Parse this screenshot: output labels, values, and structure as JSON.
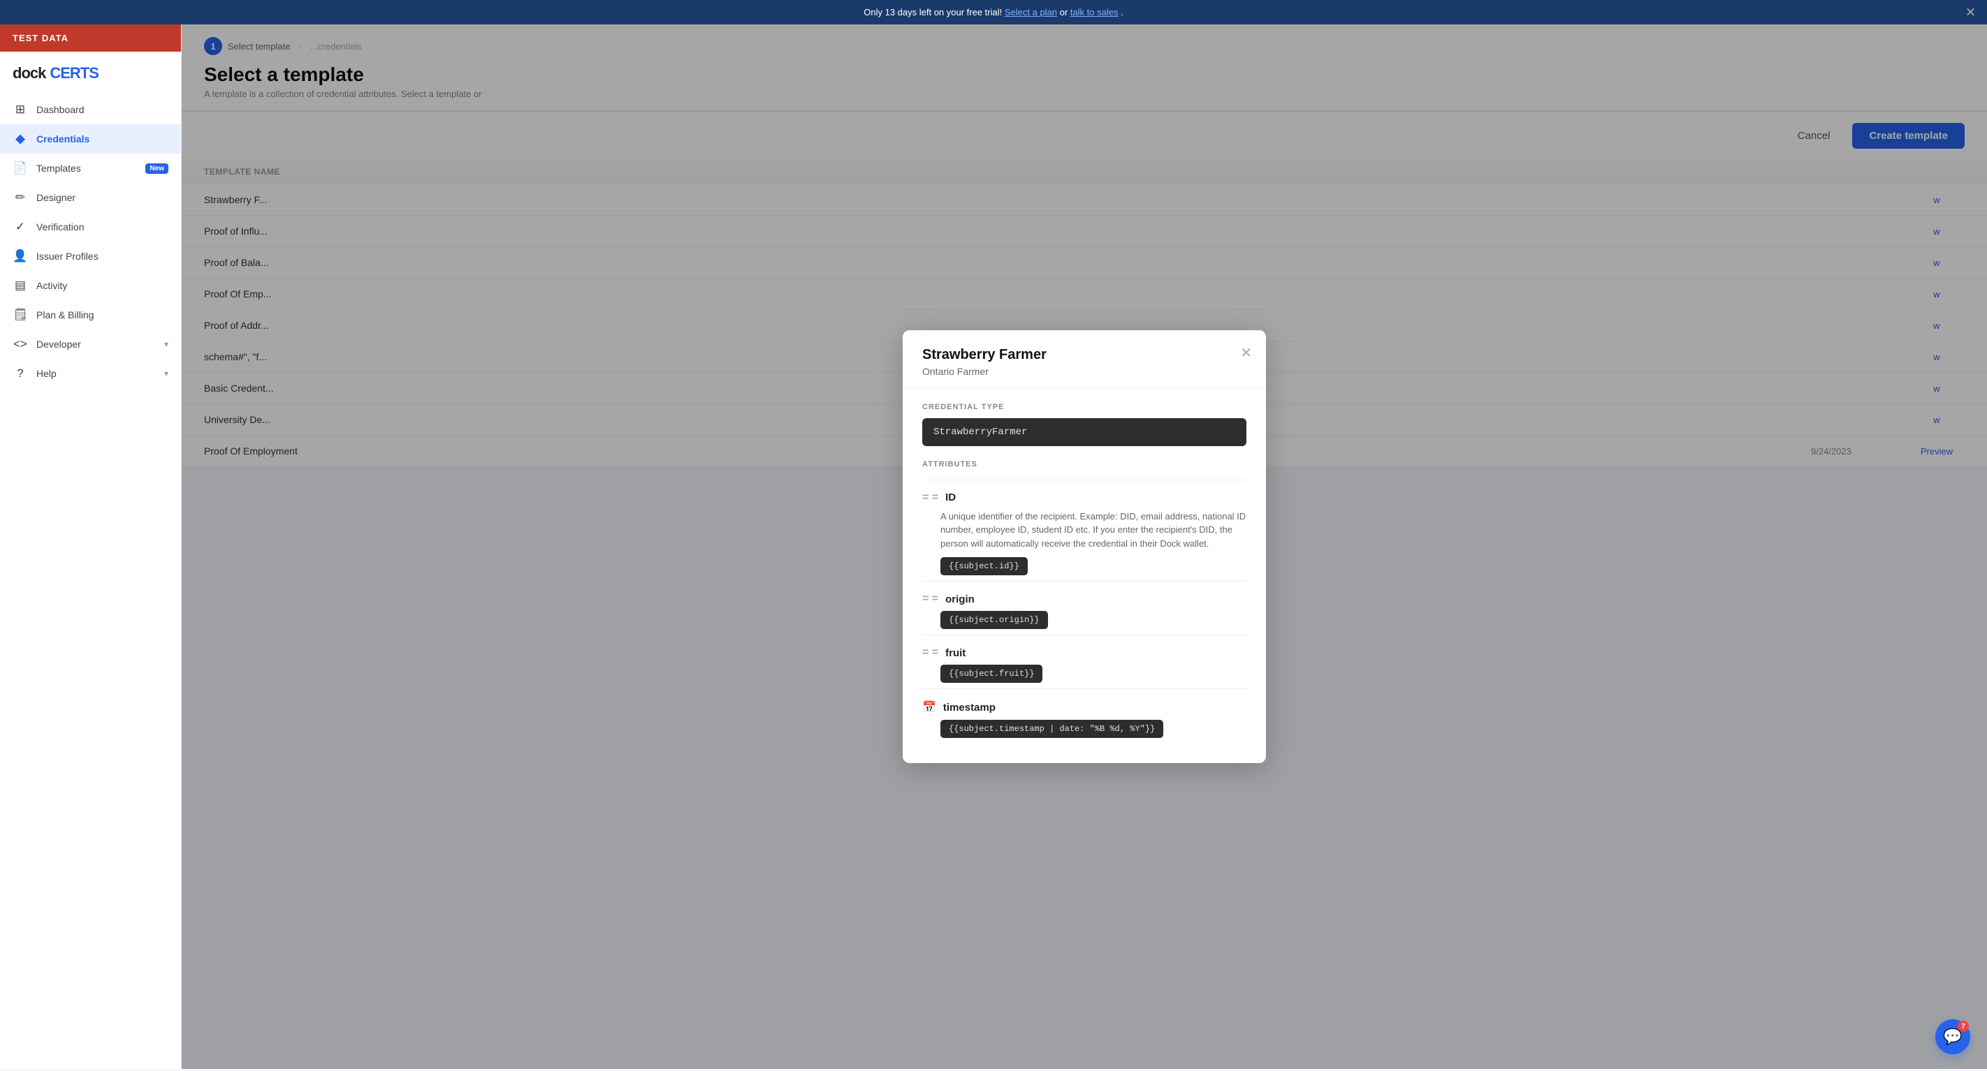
{
  "browser": {
    "url": "certs.dock.io/credentials/issue"
  },
  "banner": {
    "text": "Only 13 days left on your free trial! ",
    "link1": "Select a plan",
    "separator": " or ",
    "link2": "talk to sales",
    "suffix": "."
  },
  "sidebar": {
    "org_label": "TEST DATA",
    "logo_dock": "dock",
    "logo_certs": "CERTS",
    "nav_items": [
      {
        "id": "dashboard",
        "label": "Dashboard",
        "icon": "⊞",
        "active": false
      },
      {
        "id": "credentials",
        "label": "Credentials",
        "icon": "✦",
        "active": true
      },
      {
        "id": "templates",
        "label": "Templates",
        "icon": "📄",
        "badge": "New",
        "active": false
      },
      {
        "id": "designer",
        "label": "Designer",
        "icon": "✏️",
        "active": false
      },
      {
        "id": "verification",
        "label": "Verification",
        "icon": "✓✓",
        "active": false
      },
      {
        "id": "issuer-profiles",
        "label": "Issuer Profiles",
        "icon": "👤",
        "active": false
      },
      {
        "id": "activity",
        "label": "Activity",
        "icon": "📊",
        "active": false
      },
      {
        "id": "plan-billing",
        "label": "Plan & Billing",
        "icon": "🗒",
        "active": false
      },
      {
        "id": "developer",
        "label": "Developer",
        "icon": "<>",
        "active": false,
        "chevron": true
      },
      {
        "id": "help",
        "label": "Help",
        "icon": "?",
        "active": false,
        "chevron": true
      }
    ]
  },
  "main": {
    "step_number": "1",
    "step_label": "Select temp",
    "breadcrumb_suffix": "late",
    "page_title": "Select a",
    "page_title_full": "Select a template",
    "page_subtitle": "A template is a colle",
    "cancel_label": "Cancel",
    "create_template_label": "Create template",
    "table_header": {
      "name_col": "TEMPLATE NAME",
      "action_col": ""
    },
    "rows": [
      {
        "id": 1,
        "name": "Strawberry F...",
        "date": "",
        "action": "w"
      },
      {
        "id": 2,
        "name": "Proof of Influ...",
        "date": "",
        "action": "w"
      },
      {
        "id": 3,
        "name": "Proof of Bala...",
        "date": "",
        "action": "w"
      },
      {
        "id": 4,
        "name": "Proof Of Emp...",
        "date": "",
        "action": "w"
      },
      {
        "id": 5,
        "name": "Proof of Addr...",
        "date": "",
        "action": "w"
      },
      {
        "id": 6,
        "name": "schema#\", \"f...",
        "date": "",
        "action": "w"
      },
      {
        "id": 7,
        "name": "Basic Credent...",
        "date": "",
        "action": "w"
      },
      {
        "id": 8,
        "name": "University De...",
        "date": "",
        "action": "w"
      },
      {
        "id": 9,
        "name": "Proof Of Employment",
        "date": "9/24/2023",
        "action": "Preview"
      }
    ]
  },
  "modal": {
    "title": "Strawberry Farmer",
    "subtitle": "Ontario Farmer",
    "credential_type_label": "CREDENTIAL TYPE",
    "credential_type_value": "StrawberryFarmer",
    "attributes_label": "ATTRIBUTES",
    "attributes": [
      {
        "id": "id",
        "name": "ID",
        "icon": "equals",
        "description": "A unique identifier of the recipient. Example: DID, email address, national ID number, employee ID, student ID etc. If you enter the recipient's DID, the person will automatically receive the credential in their Dock wallet.",
        "code": "{{subject.id}}"
      },
      {
        "id": "origin",
        "name": "origin",
        "icon": "equals",
        "description": "",
        "code": "{{subject.origin}}"
      },
      {
        "id": "fruit",
        "name": "fruit",
        "icon": "equals",
        "description": "",
        "code": "{{subject.fruit}}"
      },
      {
        "id": "timestamp",
        "name": "timestamp",
        "icon": "calendar",
        "description": "",
        "code": "{{subject.timestamp | date: \"%B %d, %Y\"}}"
      }
    ]
  },
  "chat": {
    "icon": "💬",
    "badge": "7"
  }
}
